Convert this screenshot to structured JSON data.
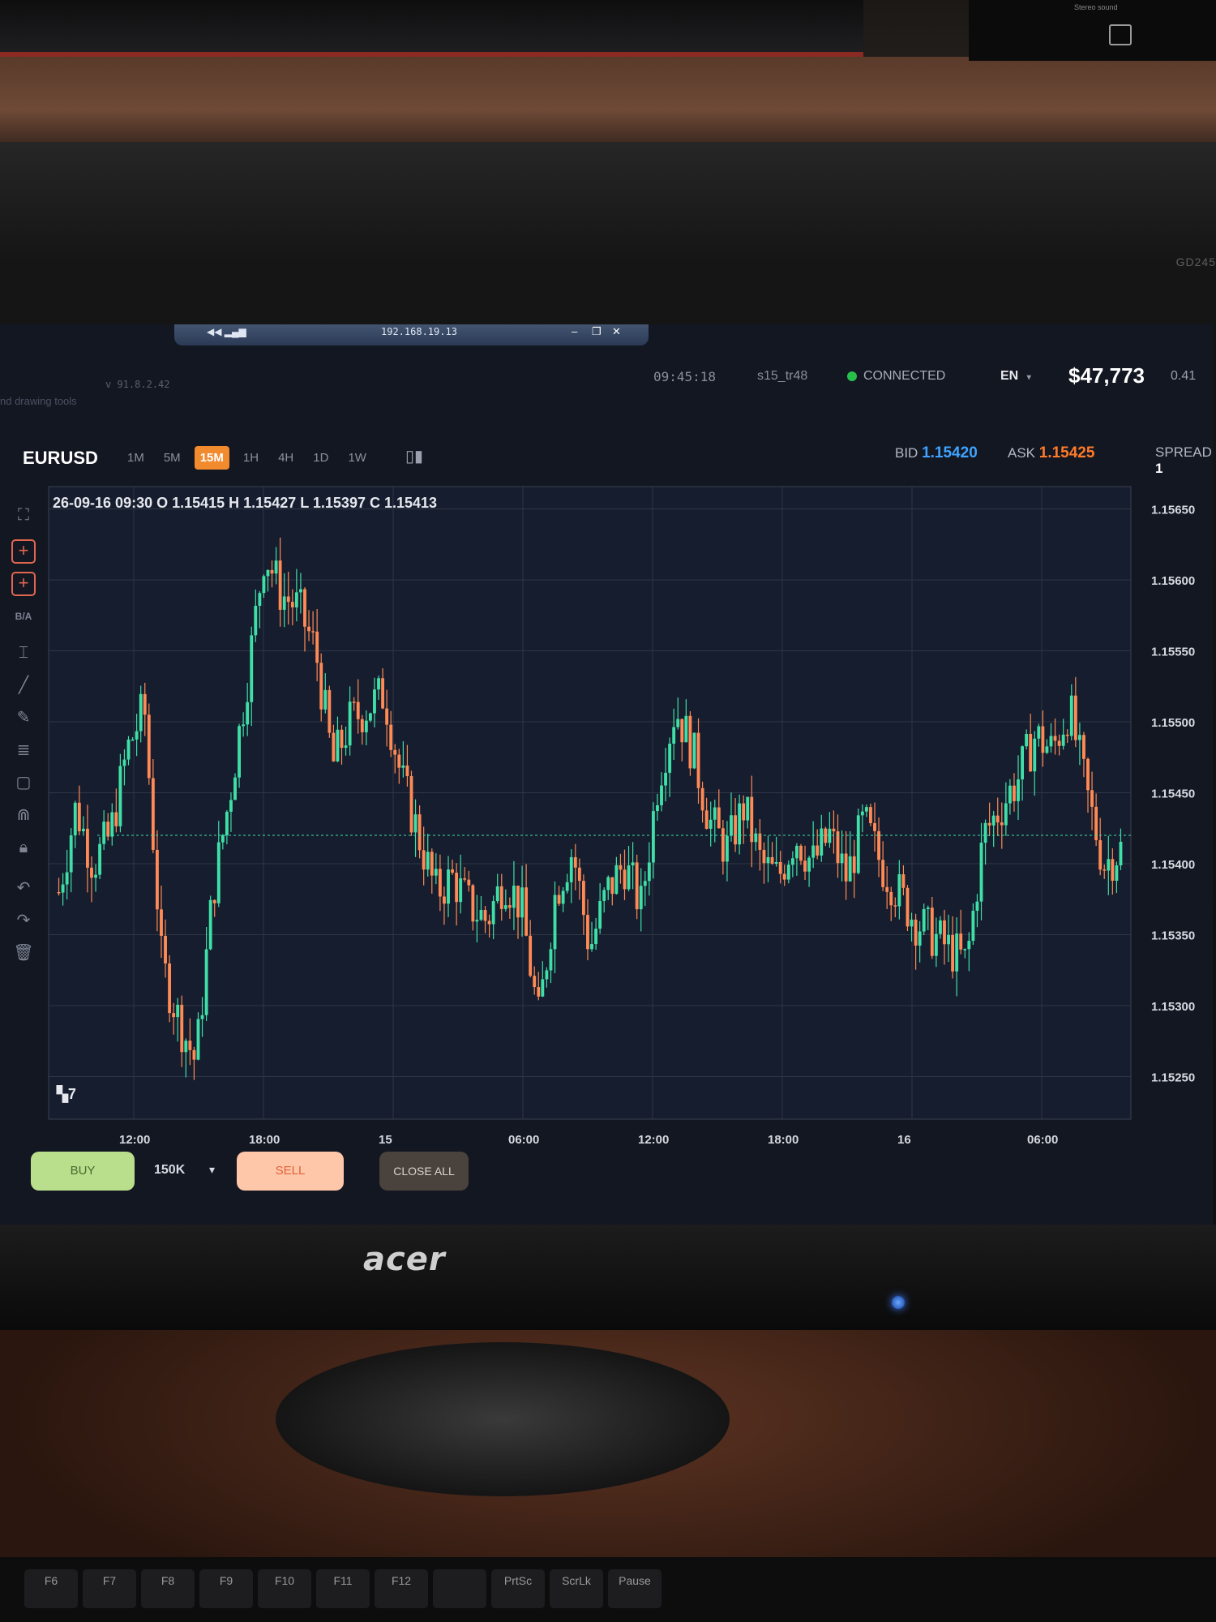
{
  "surroundings": {
    "shelf_label": "Stereo sound",
    "monitor_model": "GD245",
    "monitor_brand": "acer",
    "keys": [
      "F6",
      "F7",
      "F8",
      "F9",
      "F10",
      "F11",
      "F12",
      "",
      "PrtSc",
      "ScrLk",
      "Pause"
    ]
  },
  "remote": {
    "ip": "192.168.19.13"
  },
  "app": {
    "version": "v 91.8.2.42",
    "hint": "nd drawing tools"
  },
  "status": {
    "time": "09:45:18",
    "user": "s15_tr48",
    "connection": "CONNECTED",
    "language": "EN",
    "balance": "$47,773",
    "small_value": "0.41"
  },
  "instrument": {
    "symbol": "EURUSD",
    "timeframes": [
      "1M",
      "5M",
      "15M",
      "1H",
      "4H",
      "1D",
      "1W"
    ],
    "active_timeframe": "15M",
    "bid_label": "BID",
    "bid": "1.15420",
    "ask_label": "ASK",
    "ask": "1.15425",
    "spread_label": "SPREAD",
    "spread": "1",
    "ohlc": "26-09-16 09:30 O 1.15415 H 1.15427 L 1.15397 C 1.15413"
  },
  "toolbar": {
    "bid_ask_label": "B/A"
  },
  "trade": {
    "buy_label": "BUY",
    "lot_size": "150K",
    "sell_label": "SELL",
    "close_all_label": "CLOSE ALL"
  },
  "chart_data": {
    "type": "candlestick",
    "y_ticks": [
      "1.15650",
      "1.15600",
      "1.15550",
      "1.15500",
      "1.15450",
      "1.15400",
      "1.15350",
      "1.15300",
      "1.15250"
    ],
    "x_ticks": [
      "12:00",
      "18:00",
      "15",
      "06:00",
      "12:00",
      "18:00",
      "16",
      "06:00"
    ],
    "ylim": [
      1.1522,
      1.1566
    ],
    "current_price": 1.1542,
    "grid": true,
    "up_color": "#3fe0a8",
    "down_color": "#ff8a55",
    "path": [
      1.1538,
      1.1544,
      1.154,
      1.1542,
      1.1548,
      1.1551,
      1.1533,
      1.1529,
      1.1526,
      1.1538,
      1.1545,
      1.1553,
      1.1562,
      1.1559,
      1.1558,
      1.1555,
      1.1547,
      1.155,
      1.1551,
      1.1552,
      1.1546,
      1.1542,
      1.1538,
      1.1539,
      1.1537,
      1.1536,
      1.1539,
      1.1537,
      1.1529,
      1.1538,
      1.1541,
      1.1534,
      1.1538,
      1.154,
      1.1537,
      1.1546,
      1.1551,
      1.1548,
      1.1543,
      1.1541,
      1.1544,
      1.154,
      1.1539,
      1.1542,
      1.154,
      1.1542,
      1.1539,
      1.1543,
      1.154,
      1.1538,
      1.1536,
      1.1535,
      1.1534,
      1.1533,
      1.1542,
      1.1544,
      1.1546,
      1.1549,
      1.1548,
      1.1551,
      1.1545,
      1.154,
      1.1541
    ]
  }
}
